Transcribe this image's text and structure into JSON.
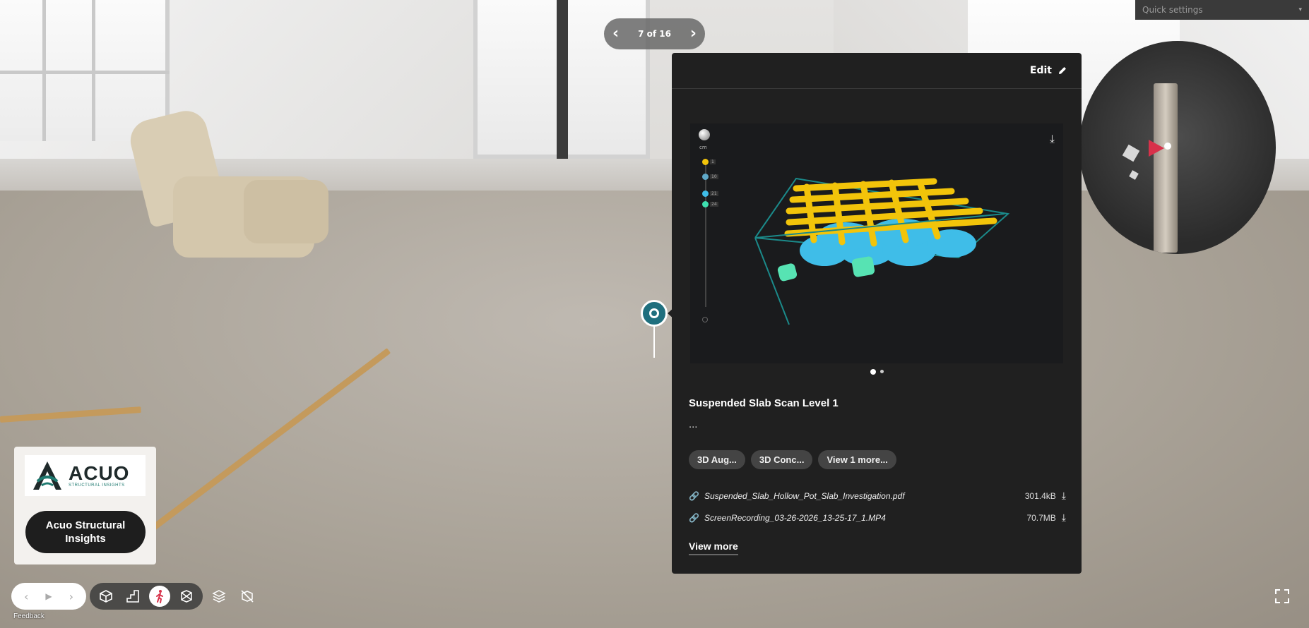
{
  "navigator": {
    "prev_label": "‹",
    "next_label": "›",
    "counter": "7 of 16"
  },
  "quick_settings": {
    "label": "Quick settings",
    "caret": "▾"
  },
  "panel": {
    "edit_label": "Edit",
    "title": "Suspended Slab Scan Level 1",
    "description": "...",
    "tags": [
      "3D Aug...",
      "3D Conc...",
      "View 1 more..."
    ],
    "files": [
      {
        "name": "Suspended_Slab_Hollow_Pot_Slab_Investigation.pdf",
        "size": "301.4kB"
      },
      {
        "name": "ScreenRecording_03-26-2026_13-25-17_1.MP4",
        "size": "70.7MB"
      }
    ],
    "view_more": "View more",
    "media": {
      "unit": "cm",
      "depth_labels": [
        "1",
        "10",
        "21",
        "24"
      ],
      "accent_colors": {
        "rebar": "#f2c40a",
        "void": "#3fbde8",
        "bounds": "#1b8a8a"
      }
    },
    "carousel": {
      "count": 2,
      "active": 1
    }
  },
  "brand": {
    "logo_text": "ACUO",
    "logo_subtext": "STRUCTURAL INSIGHTS",
    "button_label": "Acuo Structural Insights",
    "accent": "#1f7a70"
  },
  "toolbar": {
    "play_prev": "‹",
    "play": "▶",
    "play_next": "›",
    "feedback": "Feedback",
    "modes": [
      "dollhouse-icon",
      "floorplan-icon",
      "walk-icon",
      "measure-icon"
    ],
    "active_mode": "walk-icon",
    "extras": [
      "layers-icon",
      "hide-tags-icon"
    ],
    "active_color": "#d8314a"
  }
}
